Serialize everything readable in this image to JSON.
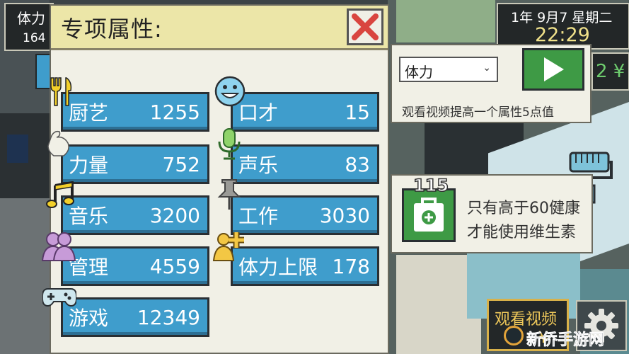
{
  "hud": {
    "stamina_label": "体力",
    "stamina_value": "164",
    "date": "1年 9月7 星期二",
    "time": "22:29",
    "money_fragment": "2 ¥"
  },
  "panel": {
    "title": "专项属性:",
    "close_icon": "close-x-icon"
  },
  "stats_left": [
    {
      "label": "厨艺",
      "value": "1255",
      "icon": "fork-knife-icon"
    },
    {
      "label": "力量",
      "value": "752",
      "icon": "muscle-icon"
    },
    {
      "label": "音乐",
      "value": "3200",
      "icon": "music-note-icon"
    },
    {
      "label": "管理",
      "value": "4559",
      "icon": "people-icon"
    },
    {
      "label": "游戏",
      "value": "12349",
      "icon": "gamepad-icon"
    }
  ],
  "stats_right": [
    {
      "label": "口才",
      "value": "15",
      "icon": "smiley-face-icon"
    },
    {
      "label": "声乐",
      "value": "83",
      "icon": "microphone-icon"
    },
    {
      "label": "工作",
      "value": "3030",
      "icon": "pushpin-icon"
    },
    {
      "label": "体力上限",
      "value": "178",
      "icon": "person-plus-icon"
    }
  ],
  "boost": {
    "selected_option": "体力",
    "description": "观看视频提高一个属性5点值",
    "play_icon": "play-icon"
  },
  "vitamin": {
    "count": "115",
    "text_line1": "只有高于60健康",
    "text_line2": "才能使用维生素",
    "icon": "medkit-bag-icon"
  },
  "bottom": {
    "watch_video_label": "观看视频",
    "watch_video_suffix": "¥",
    "settings_icon": "gear-icon",
    "watermark": "新侨手游网",
    "paint_roller_icon": "paint-roller-icon"
  },
  "colors": {
    "stat_blue": "#3f9dcc",
    "header_yellow": "#ece6a8",
    "play_green": "#3e9a45",
    "icon_yellow": "#f3d02a",
    "close_red": "#d9453f"
  }
}
